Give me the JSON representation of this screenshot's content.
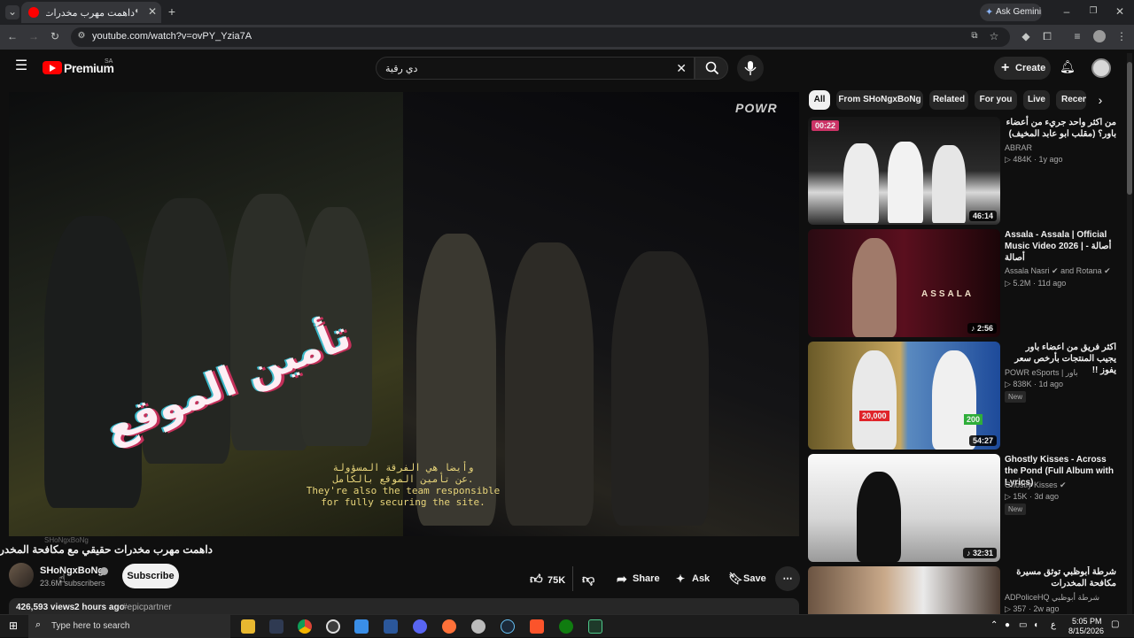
{
  "browser": {
    "tab_title": "داهمت مهرب مخدرات حقيقي",
    "new_tab_symbol": "+",
    "url": "youtube.com/watch?v=ovPY_Yzia7A",
    "ask_gemini": "Ask Gemini"
  },
  "youtube": {
    "logo_text": "Premium",
    "region": "SA",
    "search_value": "دي رقية",
    "create_label": "Create"
  },
  "video": {
    "watermark": "POWR",
    "overlay_text": "تأمين الموقع",
    "subtitle_ar_1": "وأيضا هي الفرقة المسؤولة",
    "subtitle_ar_2": "عن تأمين الموقع بالكامل.",
    "subtitle_en_1": "They're also the team responsible",
    "subtitle_en_2": "for fully securing the site.",
    "title": "داهمت مهرب مخدرات حقيقي مع مكافحة المخدرات !",
    "tooltip": "SHoNgxBoNg"
  },
  "channel": {
    "name": "SHoNgxBoNg",
    "subscribers": "23.6M subscribers",
    "subscribe_label": "Subscribe"
  },
  "actions": {
    "likes": "75K",
    "share": "Share",
    "ask": "Ask",
    "save": "Save"
  },
  "description": {
    "views": "426,593 views",
    "age": "2 hours ago",
    "hashtag": "#epicpartner"
  },
  "chips": [
    "All",
    "From SHoNgxBoNg",
    "Related",
    "For you",
    "Live",
    "Recent"
  ],
  "recommendations": [
    {
      "title": "من اكثر واحد جريء من أعضاء باور؟ (مقلب ابو عابد المخيف)",
      "channel": "ABRAR",
      "views": "484K",
      "age": "1y ago",
      "duration": "46:14",
      "progress_label": "00:22",
      "new": false
    },
    {
      "title": "Assala - Assala | Official Music Video 2026 | أصالة - أصالة",
      "channel": "Assala Nasri",
      "channel_extra": "and Rotana",
      "views": "5.2M",
      "age": "11d ago",
      "duration": "2:56",
      "thumb_text": "ASSALA",
      "new": false
    },
    {
      "title": "اكثر فريق من اعضاء باور يجيب المنتجات بأرخص سعر يفوز !!",
      "channel": "POWR eSports | باور",
      "views": "838K",
      "age": "1d ago",
      "duration": "54:27",
      "price_1": "20,000",
      "price_2": "200",
      "new": true
    },
    {
      "title": "Ghostly Kisses - Across the Pond (Full Album with Lyrics)",
      "channel": "Ghostly Kisses",
      "views": "15K",
      "age": "3d ago",
      "duration": "32:31",
      "new": true
    },
    {
      "title": "شرطة أبوظبي توثق مسيرة مكافحة المخدرات",
      "channel": "ADPoliceHQ شرطة أبوظبي",
      "views": "357",
      "age": "2w ago",
      "duration": "",
      "new": false
    }
  ],
  "taskbar": {
    "search_placeholder": "Type here to search",
    "time": "5:05 PM",
    "date": "8/15/2026",
    "lang": "ع"
  },
  "colors": {
    "brand_red": "#ff0000",
    "background": "#0f0f0f",
    "chip": "#272727"
  }
}
